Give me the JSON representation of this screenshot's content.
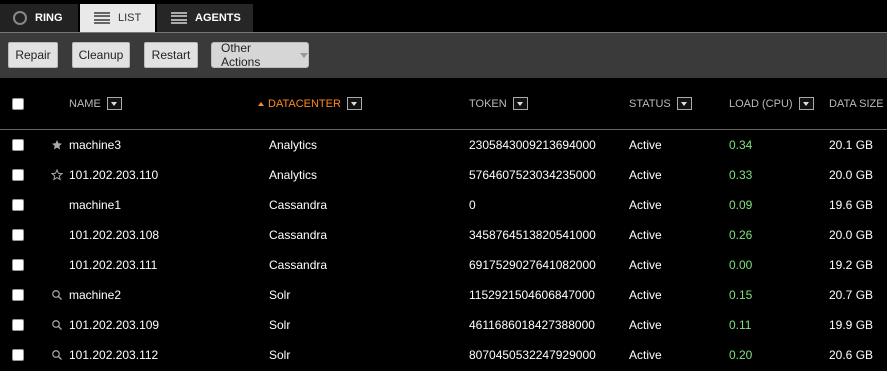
{
  "tabs": {
    "ring": "RING",
    "list": "LIST",
    "agents": "AGENTS"
  },
  "toolbar": {
    "repair": "Repair",
    "cleanup": "Cleanup",
    "restart": "Restart",
    "other_actions": "Other Actions"
  },
  "columns": {
    "name": "NAME",
    "datacenter": "DATACENTER",
    "token": "TOKEN",
    "status": "STATUS",
    "load": "LOAD (CPU)",
    "data_size": "DATA SIZE"
  },
  "sort": {
    "column": "datacenter",
    "direction": "ascending"
  },
  "colors": {
    "accent": "#ff8a1f",
    "load": "#7fe07f"
  },
  "rows": [
    {
      "mark": "star-filled-icon",
      "name": "machine3",
      "datacenter": "Analytics",
      "token": "2305843009213694000",
      "status": "Active",
      "load": "0.34",
      "size": "20.1 GB"
    },
    {
      "mark": "star-outline-icon",
      "name": "101.202.203.110",
      "datacenter": "Analytics",
      "token": "5764607523034235000",
      "status": "Active",
      "load": "0.33",
      "size": "20.0 GB"
    },
    {
      "mark": "",
      "name": "machine1",
      "datacenter": "Cassandra",
      "token": "0",
      "status": "Active",
      "load": "0.09",
      "size": "19.6 GB"
    },
    {
      "mark": "",
      "name": "101.202.203.108",
      "datacenter": "Cassandra",
      "token": "3458764513820541000",
      "status": "Active",
      "load": "0.26",
      "size": "20.0 GB"
    },
    {
      "mark": "",
      "name": "101.202.203.111",
      "datacenter": "Cassandra",
      "token": "6917529027641082000",
      "status": "Active",
      "load": "0.00",
      "size": "19.2 GB"
    },
    {
      "mark": "search-icon",
      "name": "machine2",
      "datacenter": "Solr",
      "token": "1152921504606847000",
      "status": "Active",
      "load": "0.15",
      "size": "20.7 GB"
    },
    {
      "mark": "search-icon",
      "name": "101.202.203.109",
      "datacenter": "Solr",
      "token": "4611686018427388000",
      "status": "Active",
      "load": "0.11",
      "size": "19.9 GB"
    },
    {
      "mark": "search-icon",
      "name": "101.202.203.112",
      "datacenter": "Solr",
      "token": "8070450532247929000",
      "status": "Active",
      "load": "0.20",
      "size": "20.6 GB"
    }
  ]
}
